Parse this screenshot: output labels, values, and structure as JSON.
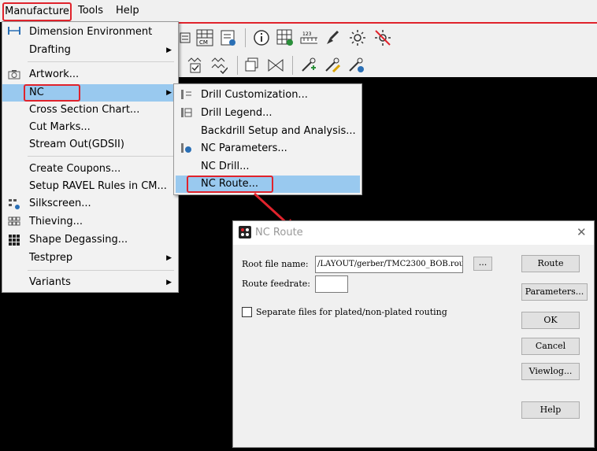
{
  "menubar": {
    "items": [
      "Manufacture",
      "Tools",
      "Help"
    ]
  },
  "manufacture_menu": {
    "items": [
      {
        "label": "Dimension Environment",
        "icon": "dimension-icon",
        "submenu": false
      },
      {
        "label": "Drafting",
        "icon": "",
        "submenu": true
      },
      {
        "label": "Artwork...",
        "icon": "camera-icon",
        "submenu": false
      },
      {
        "label": "NC",
        "icon": "",
        "submenu": true
      },
      {
        "label": "Cross Section Chart...",
        "icon": "",
        "submenu": false
      },
      {
        "label": "Cut Marks...",
        "icon": "",
        "submenu": false
      },
      {
        "label": "Stream Out(GDSII)",
        "icon": "",
        "submenu": false
      },
      {
        "label": "Create Coupons...",
        "icon": "",
        "submenu": false
      },
      {
        "label": "Setup RAVEL Rules in CM...",
        "icon": "",
        "submenu": false
      },
      {
        "label": "Silkscreen...",
        "icon": "silkscreen-icon",
        "submenu": false
      },
      {
        "label": "Thieving...",
        "icon": "thieving-icon",
        "submenu": false
      },
      {
        "label": "Shape Degassing...",
        "icon": "grid-icon",
        "submenu": false
      },
      {
        "label": "Testprep",
        "icon": "",
        "submenu": true
      },
      {
        "label": "Variants",
        "icon": "",
        "submenu": true
      }
    ]
  },
  "nc_submenu": {
    "items": [
      {
        "label": "Drill Customization...",
        "icon": "drill-custom-icon"
      },
      {
        "label": "Drill Legend...",
        "icon": "drill-legend-icon"
      },
      {
        "label": "Backdrill Setup and Analysis...",
        "icon": ""
      },
      {
        "label": "NC Parameters...",
        "icon": "nc-parameters-icon"
      },
      {
        "label": "NC Drill...",
        "icon": ""
      },
      {
        "label": "NC Route...",
        "icon": ""
      }
    ]
  },
  "toolbar": {
    "icon_text": "CM",
    "ruler_text": "123"
  },
  "dialog": {
    "title": "NC Route",
    "root_file_label": "Root file name:",
    "root_file_value": "/LAYOUT/gerber/TMC2300_BOB.rou",
    "browse_label": "...",
    "feedrate_label": "Route feedrate:",
    "feedrate_value": "",
    "checkbox_label": "Separate files for plated/non-plated routing",
    "checkbox_checked": false,
    "buttons": [
      "Route",
      "Parameters...",
      "OK",
      "Cancel",
      "Viewlog...",
      "Help"
    ],
    "close_label": "✕"
  },
  "colors": {
    "highlight": "#99c9ef",
    "annotation_red": "#e0232c"
  }
}
